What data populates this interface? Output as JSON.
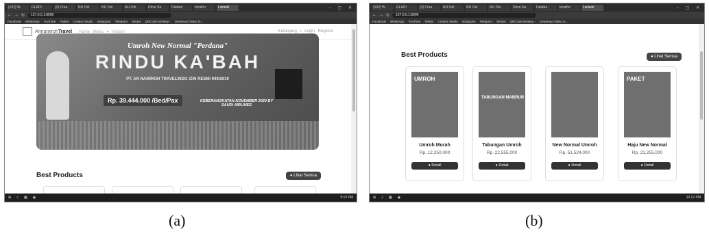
{
  "panels": [
    {
      "tabs": [
        "(102) W",
        "GLAD!",
        "(3) Crea",
        "NU Onl",
        "NU Onl",
        "NU Onl",
        "Drive Sa",
        "Databa",
        "localho",
        "Laravel"
      ],
      "url": "127.0.0.1:8000",
      "bookmarks": [
        "Facebook",
        "WhatsApp",
        "YouTube",
        "Twitter",
        "Creator Studio",
        "Instagram",
        "Telegram",
        "Skripsi",
        "QRCode Monkey -",
        "Download Video In..."
      ],
      "brand_light": "Annamiroh",
      "brand_bold": "Travel",
      "nav_links": "Home  Menu ▾  History",
      "nav_right": "Keranjang ▪  Login  Register",
      "banner": {
        "subtitle": "Umroh New Normal \"Perdana\"",
        "title": "RINDU KA'BAH",
        "company": "PT. AN NAMIROH TRAVELINDO IZIN RESMI 949/2019",
        "price": "Rp. 39.444.000 /Bed/Pax",
        "departure": "KEBERANGKATAN NOVEMBER 2020 BY SAUDI AIRLINES"
      },
      "section_title": "Best Products",
      "see_all": "● Lihat Semua",
      "time": "9:10 PM",
      "caption": "(a)"
    },
    {
      "tabs": [
        "(102) W",
        "GLAD!",
        "(3) Crea",
        "NU Onl",
        "NU Onl",
        "NU Onl",
        "Drive Sa",
        "Databa",
        "localho",
        "Laravel"
      ],
      "url": "127.0.0.1:8000",
      "bookmarks": [
        "Facebook",
        "WhatsApp",
        "YouTube",
        "Twitter",
        "Creator Studio",
        "Instagram",
        "Telegram",
        "Skripsi",
        "QRCode Monkey -",
        "Download Video In..."
      ],
      "section_title": "Best Products",
      "see_all": "● Lihat Semua",
      "products": [
        {
          "name": "Umroh Murah",
          "price": "Rp. 12,250,000",
          "button": "● Detail",
          "img_text": "UMROH"
        },
        {
          "name": "Tabungan Umroh",
          "price": "Rp. 22,555,000",
          "button": "● Detail",
          "img_text": "TABUNGAN MABRUR"
        },
        {
          "name": "New Normal Umroh",
          "price": "Rp. 51,524,000",
          "button": "● Detail",
          "img_text": ""
        },
        {
          "name": "Haju New Normal",
          "price": "Rp. 21,255,000",
          "button": "● Detail",
          "img_text": "PAKET"
        }
      ],
      "time": "10:12 PM",
      "caption": "(b)"
    }
  ]
}
